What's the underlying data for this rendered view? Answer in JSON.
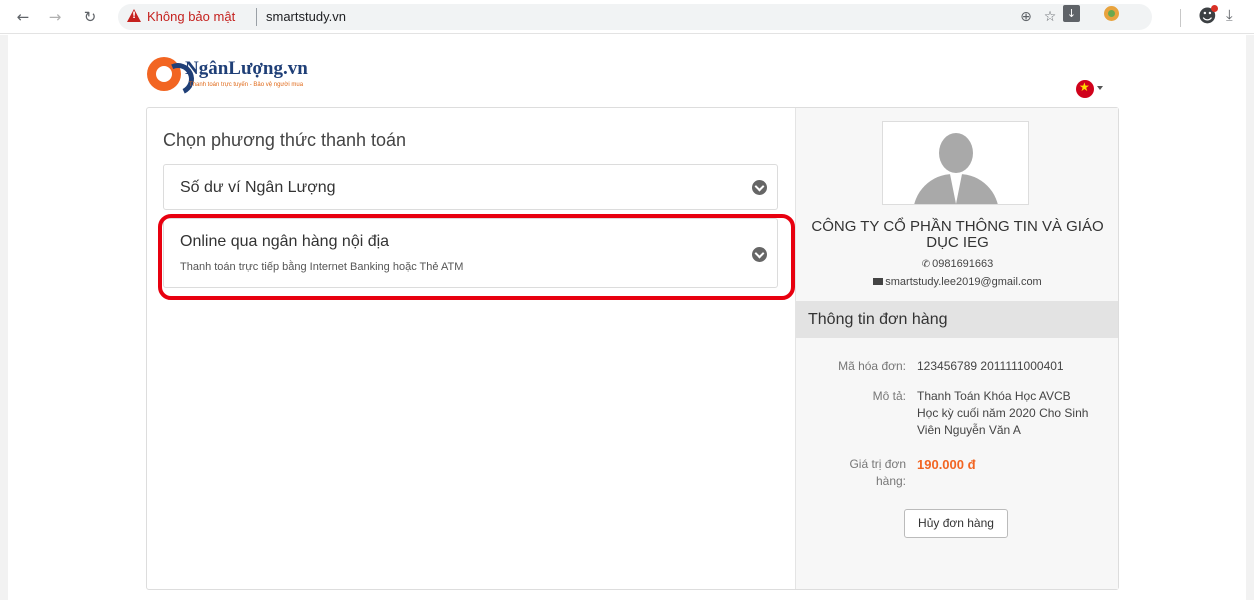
{
  "browser": {
    "security_label": "Không bảo mật",
    "url": "smartstudy.vn",
    "icons": [
      "back-arrow-icon",
      "forward-arrow-icon",
      "reload-icon",
      "warning-icon",
      "zoom-icon",
      "star-icon",
      "download-icon",
      "extension-icon",
      "profile-icon",
      "download-tray-icon"
    ],
    "colors": {
      "warning": "#c5221f",
      "omnibox": "#f1f3f4"
    }
  },
  "logo": {
    "name": "NgânLượng.vn",
    "tagline": "Thanh toán trực tuyến - Bảo vệ người mua"
  },
  "payment": {
    "section_title": "Chọn phương thức thanh toán",
    "methods": [
      {
        "name": "Số dư ví Ngân Lượng",
        "description": ""
      },
      {
        "name": "Online qua ngân hàng nội địa",
        "description": "Thanh toán trực tiếp bằng Internet Banking hoặc Thẻ ATM"
      }
    ],
    "highlight_color": "#e8000f"
  },
  "merchant": {
    "name": "CÔNG TY CỔ PHẦN THÔNG TIN VÀ GIÁO DỤC IEG",
    "phone": "0981691663",
    "email": "smartstudy.lee2019@gmail.com"
  },
  "order": {
    "title": "Thông tin đơn hàng",
    "invoice_label": "Mã hóa đơn:",
    "invoice_value": "123456789 2011111000401",
    "description_label": "Mô tả:",
    "description_value": "Thanh Toán Khóa Học AVCB Học kỳ cuối năm 2020 Cho Sinh Viên Nguyễn Văn A",
    "amount_label": "Giá trị đơn hàng:",
    "amount_value": "190.000 đ",
    "cancel_label": "Hủy đơn hàng",
    "accent_color": "#f26522"
  }
}
